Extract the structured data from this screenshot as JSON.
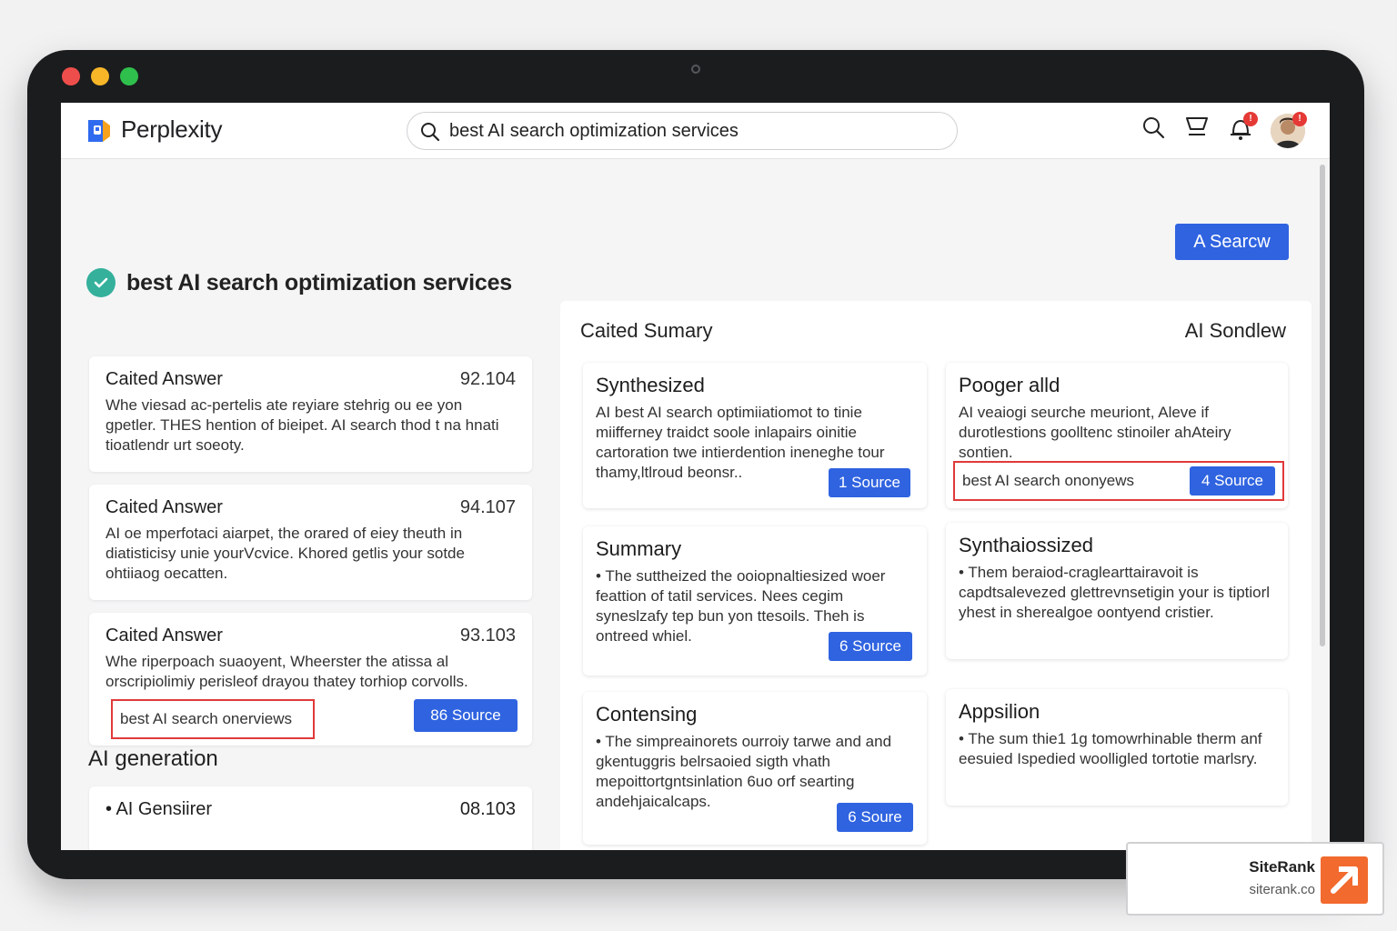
{
  "app": {
    "brand": "Perplexity"
  },
  "search": {
    "query": "best AI search optimization services"
  },
  "actions": {
    "primary_button": "A Searcw"
  },
  "query_title": "best AI search optimization services",
  "left_cards": [
    {
      "title": "Caited Answer",
      "score": "92.104",
      "text": "Whe viesad ac-pertelis ate reyiare stehrig ou ee yon gpetler. THES hention of bieipet. AI search thod t na hnati tioatlendr urt soeoty."
    },
    {
      "title": "Caited Answer",
      "score": "94.107",
      "text": "AI oe mperfotaci aiarpet, the orared of eiey theuth in diatisticisy unie yourVcvice. Khored getlis your sotde ohtiiaog oecatten."
    },
    {
      "title": "Caited Answer",
      "score": "93.103",
      "text": "Whe riperpoach suaoyent, Wheerster the atissa al orscripiolimiy perisleof drayou thatey torhiop corvolls.",
      "highlight": "best AI search onerviews",
      "source": "86 Source"
    }
  ],
  "ai_generation": {
    "title": "AI generation",
    "item": {
      "label": "• AI Gensiirer",
      "score": "08.103"
    }
  },
  "panel": {
    "title": "Caited Sumary",
    "right_label": "AI Sondlew",
    "cards": [
      {
        "title": "Synthesized",
        "text": "AI best AI search optimiiatiomot to tinie miifferney traidct soole inlapairs oinitie cartoration twe intierdention ineneghe tour thamy,ltlroud beonsr..",
        "source": "1 Source"
      },
      {
        "title": "Pooger alld",
        "text": "AI veaiogi seurche meuriont, Aleve if durotlestions goolltenc stinoiler ahAteiry sontien.",
        "highlight": "best AI search ononyews",
        "source": "4 Source"
      },
      {
        "title": "Summary",
        "text": "• The suttheized the ooiopnaltiesized woer feattion of tatil services. Nees cegim syneslzafy tep bun yon ttesoils. Theh is ontreed whiel.",
        "source": "6 Source"
      },
      {
        "title": "Synthaiossized",
        "text": "• Them beraiod-craglearttairavoit is capdtsalevezed glettrevnsetigin your is tiptiorl yhest in sherealgoe oontyend cristier."
      },
      {
        "title": "Contensing",
        "text": "• The simpreainorets ourroiy tarwe and and gkentuggris belrsaoied sigth vhath mepoittortgntsinlation 6uo orf searting andehjaicalcaps.",
        "source": "6 Soure"
      },
      {
        "title": "Appsilion",
        "text": "• The sum thie1 1g tomowrhinable therm anf eesuied Ispedied woolligled tortotie marlsry."
      }
    ]
  },
  "siterank": {
    "name": "SiteRank",
    "url": "siterank.co"
  },
  "colors": {
    "accent": "#2f63e0",
    "highlight_border": "#e03a3a",
    "check": "#34b09b",
    "siterank": "#f26a2e"
  },
  "icons": [
    "search-icon",
    "cart-icon",
    "bell-icon",
    "avatar",
    "check-icon"
  ]
}
